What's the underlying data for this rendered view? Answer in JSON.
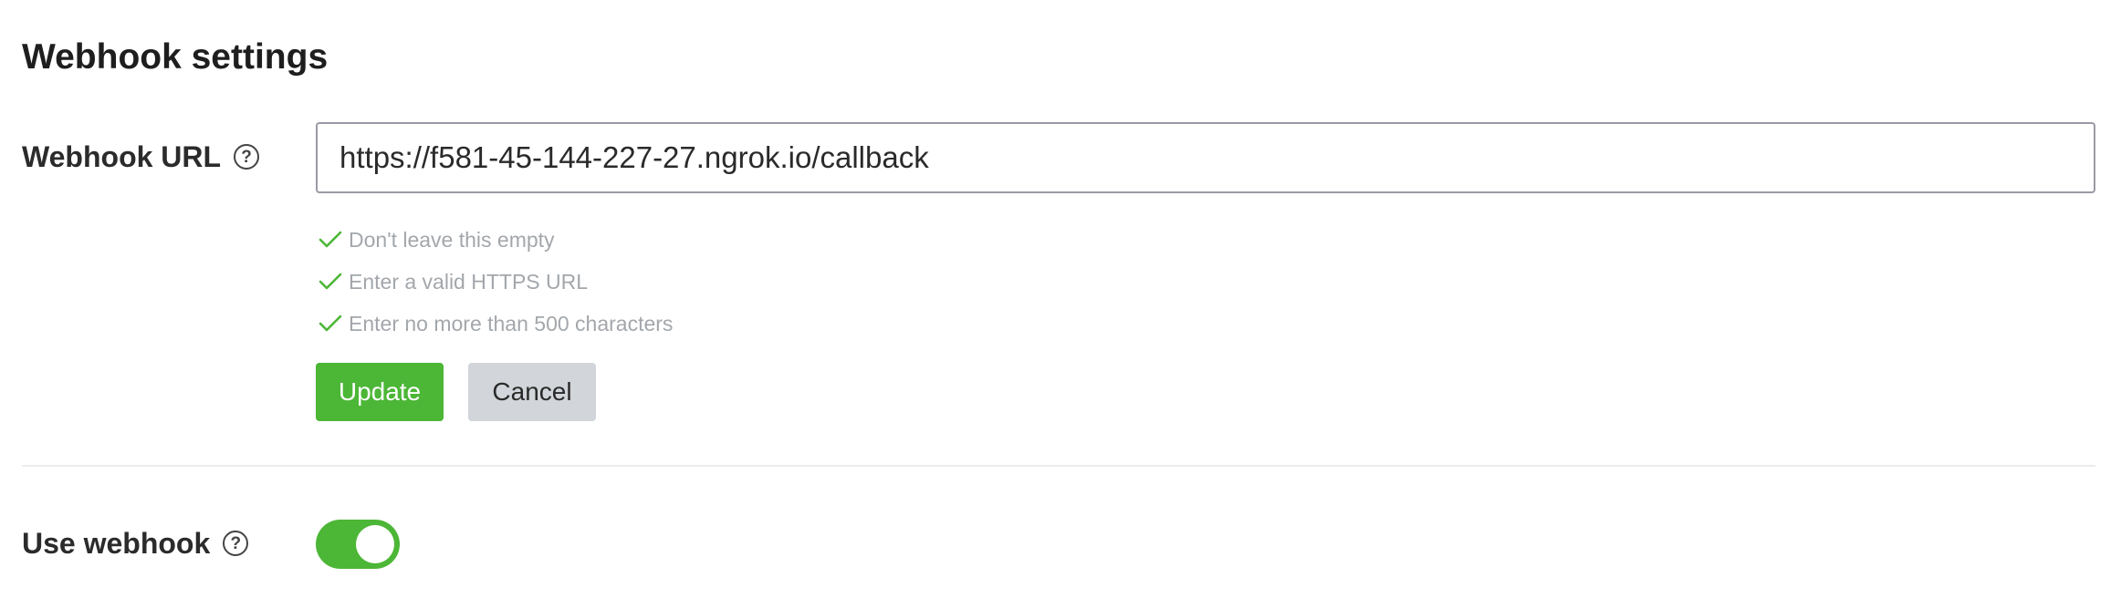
{
  "section": {
    "title": "Webhook settings"
  },
  "webhook_url": {
    "label": "Webhook URL",
    "help_icon": "question-circle-icon",
    "value": "https://f581-45-144-227-27.ngrok.io/callback",
    "rules": [
      {
        "text": "Don't leave this empty",
        "icon": "check-icon",
        "status": "passed"
      },
      {
        "text": "Enter a valid HTTPS URL",
        "icon": "check-icon",
        "status": "passed"
      },
      {
        "text": "Enter no more than 500 characters",
        "icon": "check-icon",
        "status": "passed"
      }
    ],
    "update_label": "Update",
    "cancel_label": "Cancel"
  },
  "use_webhook": {
    "label": "Use webhook",
    "help_icon": "question-circle-icon",
    "enabled": true
  },
  "colors": {
    "accent_green": "#4cb636",
    "rule_text": "#a3a7ab",
    "cancel_bg": "#d2d5d9"
  }
}
